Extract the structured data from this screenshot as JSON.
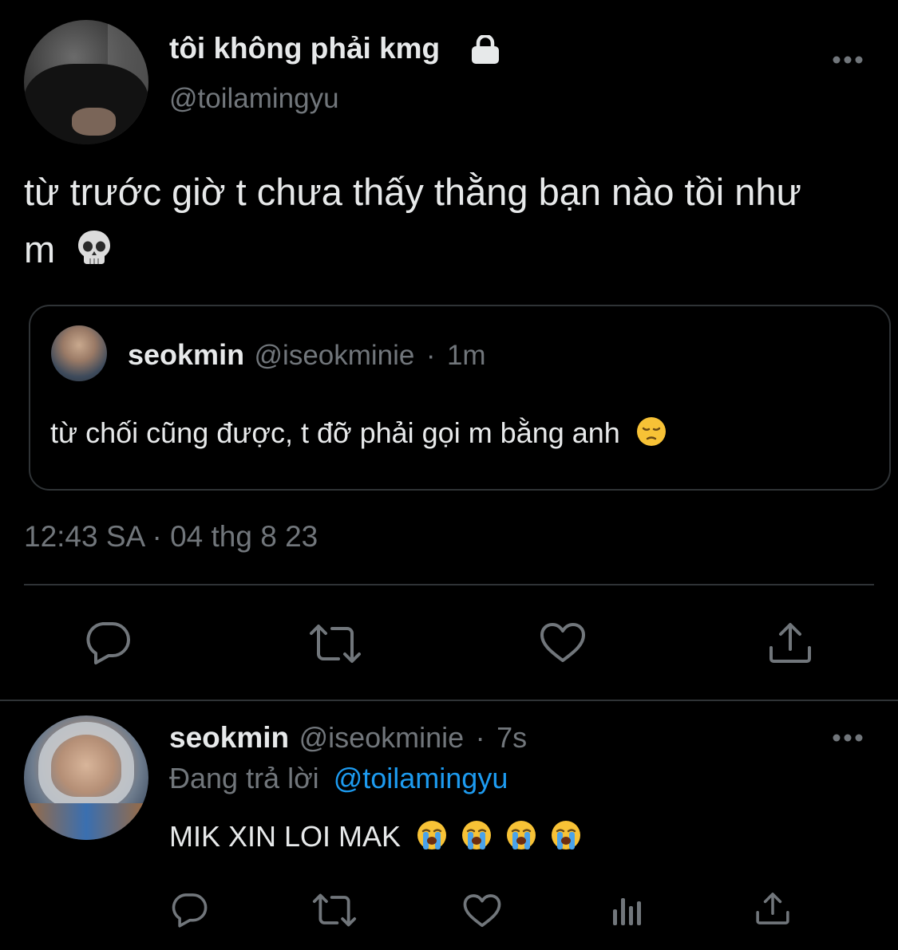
{
  "main_tweet": {
    "display_name": "tôi không phải kmg",
    "handle": "@toilamingyu",
    "text_line1": "từ trước giờ t chưa thấy thằng bạn nào tồi như",
    "text_line2": "m",
    "text_emoji": "skull-emoji",
    "timestamp": "12:43 SA · 04 thg 8 23",
    "protected_icon": "lock-icon"
  },
  "quoted_tweet": {
    "display_name": "seokmin",
    "handle": "@iseokminie",
    "separator": "·",
    "time_ago": "1m",
    "text": "từ chối cũng được, t đỡ phải gọi m bằng anh",
    "text_emoji": "pensive-face-emoji"
  },
  "reply": {
    "display_name": "seokmin",
    "handle": "@iseokminie",
    "separator": "·",
    "time_ago": "7s",
    "replying_prefix": "Đang trả lời",
    "replying_to": "@toilamingyu",
    "text": "MIK XIN LOI MAK",
    "text_emoji": "loudly-crying-face-emoji"
  },
  "icons": {
    "reply": "reply-icon",
    "retweet": "retweet-icon",
    "like": "heart-icon",
    "share": "share-icon",
    "analytics": "analytics-icon",
    "more": "more-icon"
  },
  "colors": {
    "background": "#000000",
    "text_primary": "#e7e9ea",
    "text_secondary": "#71767b",
    "border": "#2f3336",
    "link": "#1d9bf0"
  }
}
